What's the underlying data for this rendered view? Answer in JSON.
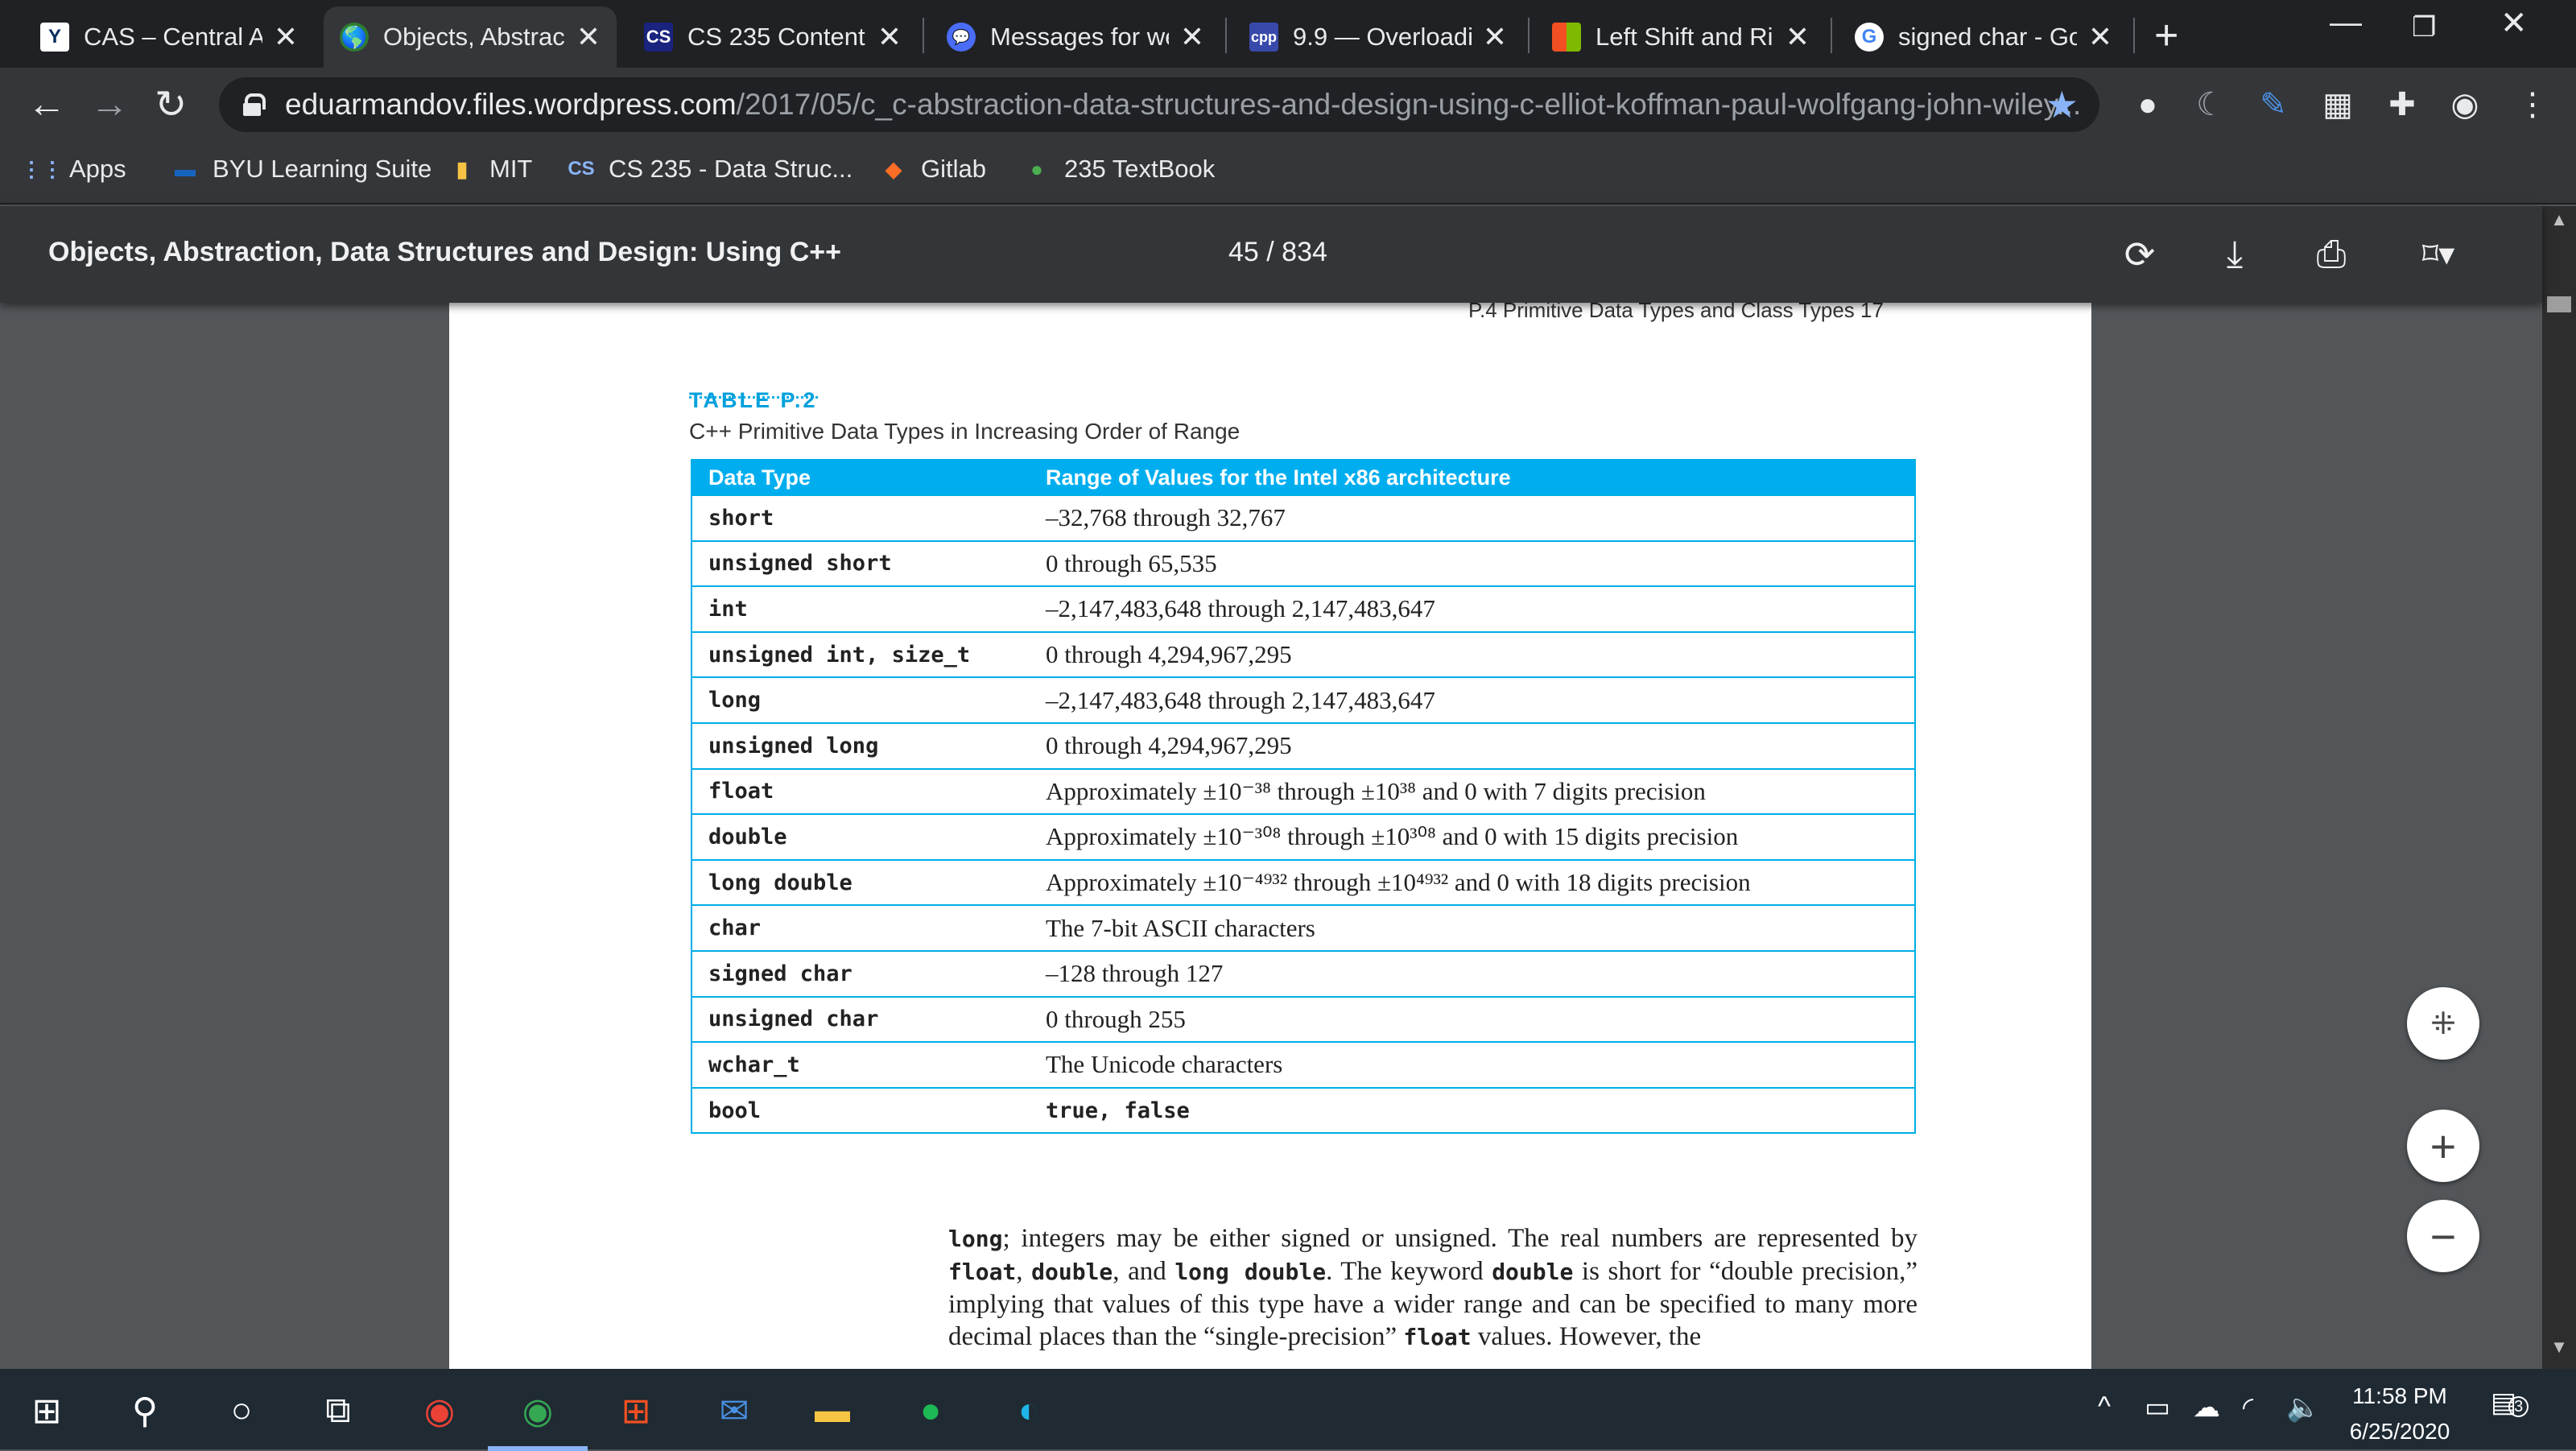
{
  "tabs": [
    {
      "title": "CAS – Central Au",
      "icon": "Y"
    },
    {
      "title": "Objects, Abstrac",
      "icon": "🌎"
    },
    {
      "title": "CS 235 Content",
      "icon": "CS"
    },
    {
      "title": "Messages for we",
      "icon": "💬"
    },
    {
      "title": "9.9 — Overloadi",
      "icon": "cpp"
    },
    {
      "title": "Left Shift and Ri",
      "icon": "▦"
    },
    {
      "title": "signed char - Go",
      "icon": "G"
    }
  ],
  "toolbar": {
    "url_host": "eduarmandov.files.wordpress.com",
    "url_path": "/2017/05/c_c-abstraction-data-structures-and-design-using-c-elliot-koffman-paul-wolfgang-john-wiley..."
  },
  "bookmarks": [
    {
      "label": "Apps",
      "icon": "apps-icon"
    },
    {
      "label": "BYU Learning Suite",
      "icon": "byu-icon"
    },
    {
      "label": "MIT",
      "icon": "folder-icon"
    },
    {
      "label": "CS 235 - Data Struc...",
      "icon": "cs-icon"
    },
    {
      "label": "Gitlab",
      "icon": "gitlab-icon"
    },
    {
      "label": "235 TextBook",
      "icon": "globe-icon"
    }
  ],
  "pdf": {
    "title": "Objects, Abstraction, Data Structures and Design: Using C++",
    "page_indicator": "45 / 834"
  },
  "page": {
    "running_head": "P.4  Primitive Data Types and Class Types     17",
    "table_label": "TABLE P.2",
    "table_caption": "C++ Primitive Data Types in Increasing Order of Range",
    "columns": [
      "Data Type",
      "Range of Values for the Intel x86 architecture"
    ],
    "rows": [
      {
        "type": "short",
        "range": "–32,768 through 32,767"
      },
      {
        "type": "unsigned short",
        "range": "0 through 65,535"
      },
      {
        "type": "int",
        "range": "–2,147,483,648 through 2,147,483,647"
      },
      {
        "type": "unsigned int, size_t",
        "range": "0 through 4,294,967,295"
      },
      {
        "type": "long",
        "range": "–2,147,483,648 through 2,147,483,647"
      },
      {
        "type": "unsigned long",
        "range": "0 through 4,294,967,295"
      },
      {
        "type": "float",
        "range": "Approximately ±10⁻³⁸ through ±10³⁸ and 0 with 7 digits precision"
      },
      {
        "type": "double",
        "range": "Approximately ±10⁻³⁰⁸ through ±10³⁰⁸ and 0 with 15 digits precision"
      },
      {
        "type": "long double",
        "range": "Approximately ±10⁻⁴⁹³² through ±10⁴⁹³² and 0 with 18 digits precision"
      },
      {
        "type": "char",
        "range": "The 7-bit ASCII characters"
      },
      {
        "type": "signed char",
        "range": "–128 through 127"
      },
      {
        "type": "unsigned char",
        "range": "0 through 255"
      },
      {
        "type": "wchar_t",
        "range": "The Unicode characters"
      },
      {
        "type": "bool",
        "range": "true, false"
      }
    ],
    "paragraph": [
      {
        "code": "long"
      },
      {
        "text": "; integers may be either signed or unsigned. The real numbers are represented by "
      },
      {
        "code": "float"
      },
      {
        "text": ", "
      },
      {
        "code": "double"
      },
      {
        "text": ", and "
      },
      {
        "code": "long double"
      },
      {
        "text": ". The keyword "
      },
      {
        "code": "double"
      },
      {
        "text": " is short for “double precision,” implying that values of this type have a wider range and can be specified to many more decimal places than the “single-precision” "
      },
      {
        "code": "float"
      },
      {
        "text": " values. However, the"
      }
    ]
  },
  "taskbar": {
    "time": "11:58 PM",
    "date": "6/25/2020",
    "notification_count": "3"
  }
}
